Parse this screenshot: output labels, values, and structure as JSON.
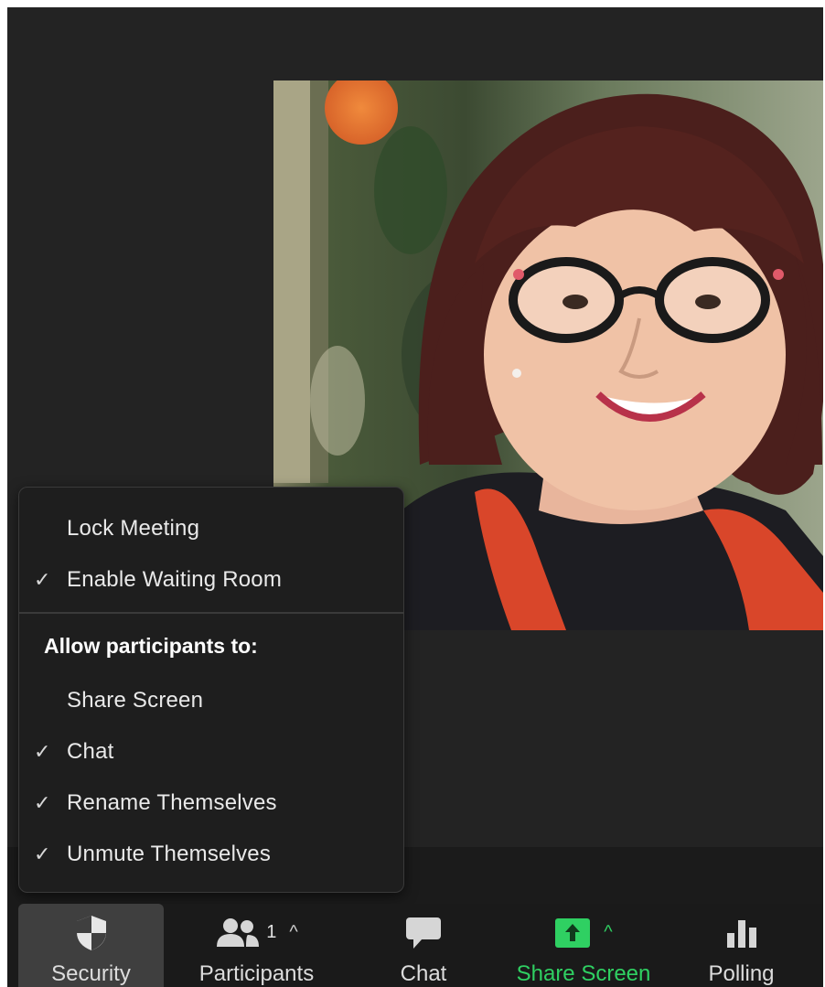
{
  "menu": {
    "items_top": [
      {
        "label": "Lock Meeting",
        "checked": false
      },
      {
        "label": "Enable Waiting Room",
        "checked": true
      }
    ],
    "section_header": "Allow participants to:",
    "items_bottom": [
      {
        "label": "Share Screen",
        "checked": false
      },
      {
        "label": "Chat",
        "checked": true
      },
      {
        "label": "Rename Themselves",
        "checked": true
      },
      {
        "label": "Unmute Themselves",
        "checked": true
      }
    ],
    "check_glyph": "✓"
  },
  "toolbar": {
    "security_label": "Security",
    "participants_label": "Participants",
    "participants_count": "1",
    "chat_label": "Chat",
    "share_label": "Share Screen",
    "polling_label": "Polling"
  },
  "colors": {
    "background": "#232323",
    "toolbar": "#1a1a1a",
    "active_button": "#3f3f3f",
    "share_green": "#2fd062"
  },
  "icons": {
    "security": "shield-icon",
    "participants": "people-icon",
    "chat": "speech-bubble-icon",
    "share": "up-arrow-icon",
    "polling": "bar-chart-icon"
  }
}
